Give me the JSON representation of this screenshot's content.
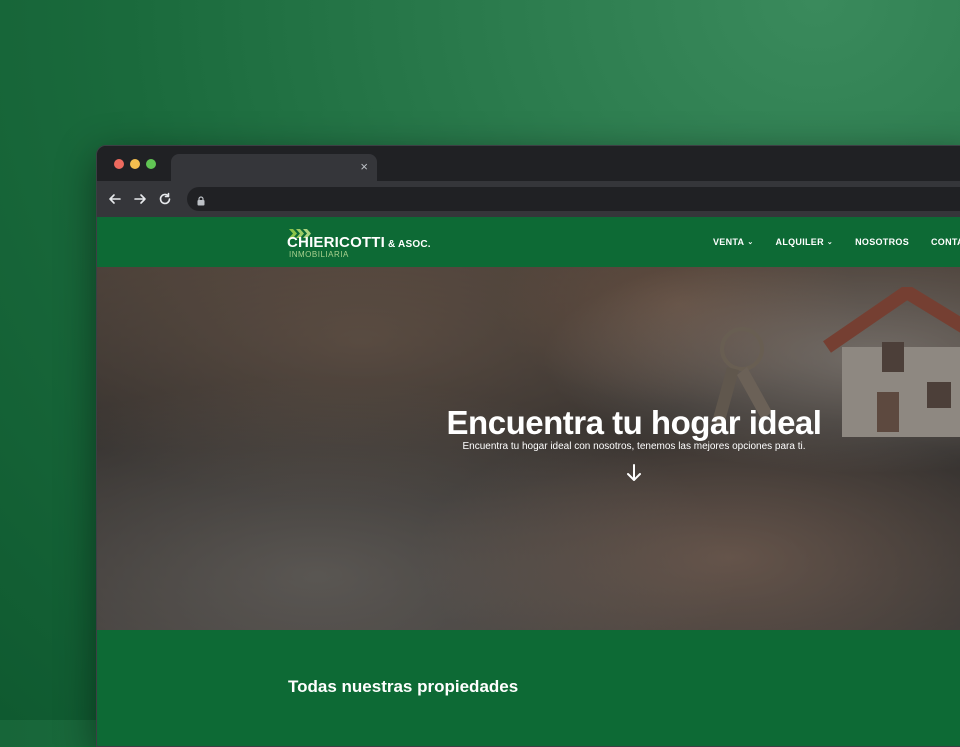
{
  "browser": {
    "tab_close": "×"
  },
  "site": {
    "logo": {
      "name": "CHIERICOTTI",
      "suffix": "& ASOC.",
      "subtitle": "INMOBILIARIA"
    },
    "menu": [
      {
        "label": "VENTA",
        "has_dropdown": true
      },
      {
        "label": "ALQUILER",
        "has_dropdown": true
      },
      {
        "label": "NOSOTROS",
        "has_dropdown": false
      },
      {
        "label": "CONTACTO",
        "has_dropdown": false
      }
    ],
    "chevron": "⌄"
  },
  "hero": {
    "title": "Encuentra tu hogar ideal",
    "subtitle": "Encuentra tu hogar ideal con nosotros, tenemos las mejores opciones para ti."
  },
  "section": {
    "title": "Todas nuestras propiedades"
  },
  "colors": {
    "brand_green": "#0d6a35",
    "logo_accent": "#8bc34a",
    "browser_dark": "#202124",
    "browser_toolbar": "#35363a"
  }
}
